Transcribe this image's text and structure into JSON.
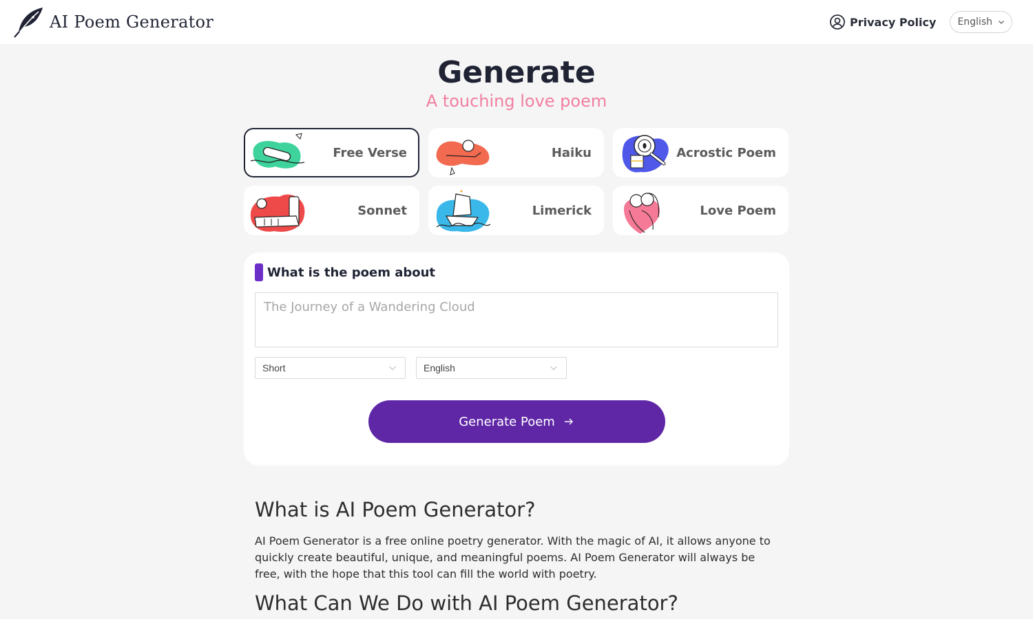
{
  "header": {
    "brand_name": "AI Poem Generator",
    "logo_icon": "feather-quill-icon",
    "privacy_label": "Privacy Policy",
    "privacy_icon": "user-circle-icon",
    "language_label": "English"
  },
  "hero": {
    "title": "Generate",
    "subtitle": "A touching love poem"
  },
  "poem_types": [
    {
      "label": "Free Verse",
      "illustration": "bottle-in-sea",
      "accent": "#3ed39c",
      "selected": true
    },
    {
      "label": "Haiku",
      "illustration": "person-relaxing",
      "accent": "#f26a4f",
      "selected": false
    },
    {
      "label": "Acrostic Poem",
      "illustration": "magnifying-glass",
      "accent": "#4f58e8",
      "selected": false
    },
    {
      "label": "Sonnet",
      "illustration": "person-with-scroll",
      "accent": "#ee4a4a",
      "selected": false
    },
    {
      "label": "Limerick",
      "illustration": "ship-on-waves",
      "accent": "#3bb8ea",
      "selected": false
    },
    {
      "label": "Love Poem",
      "illustration": "couple-hugging",
      "accent": "#f57a97",
      "selected": false
    }
  ],
  "form": {
    "title": "What is the poem about",
    "topic_placeholder": "The Journey of a Wandering Cloud",
    "topic_value": "",
    "length_select": "Short",
    "language_select": "English",
    "submit_label": "Generate Poem"
  },
  "about": {
    "heading1": "What is AI Poem Generator?",
    "paragraph1": "AI Poem Generator is a free online poetry generator. With the magic of AI, it allows anyone to quickly create beautiful, unique, and meaningful poems. AI Poem Generator will always be free, with the hope that this tool can fill the world with poetry.",
    "heading2": "What Can We Do with AI Poem Generator?"
  },
  "colors": {
    "accent_purple": "#5f27a6",
    "subtitle_pink": "#f27ea0",
    "title_dark": "#1f2333"
  }
}
